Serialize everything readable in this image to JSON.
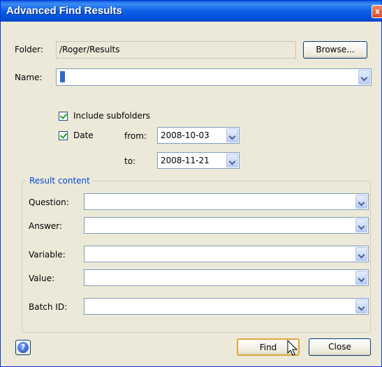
{
  "window": {
    "title": "Advanced Find Results"
  },
  "folder": {
    "label": "Folder:",
    "value": "/Roger/Results",
    "browse_label": "Browse..."
  },
  "name": {
    "label": "Name:",
    "value": ""
  },
  "options": {
    "include_subfolders_label": "Include subfolders",
    "include_subfolders_checked": true,
    "date_label": "Date",
    "date_checked": true,
    "from_label": "from:",
    "from_value": "2008-10-03",
    "to_label": "to:",
    "to_value": "2008-11-21"
  },
  "result_content": {
    "legend": "Result content",
    "fields": [
      {
        "label": "Question:",
        "value": ""
      },
      {
        "label": "Answer:",
        "value": ""
      },
      {
        "label": "Variable:",
        "value": ""
      },
      {
        "label": "Value:",
        "value": ""
      },
      {
        "label": "Batch ID:",
        "value": ""
      }
    ]
  },
  "buttons": {
    "help_glyph": "?",
    "find_label": "Find",
    "close_label": "Close"
  },
  "colors": {
    "titlebar": "#0b5ee6",
    "dialog_bg": "#ece9d8",
    "accent": "#0046d5"
  }
}
